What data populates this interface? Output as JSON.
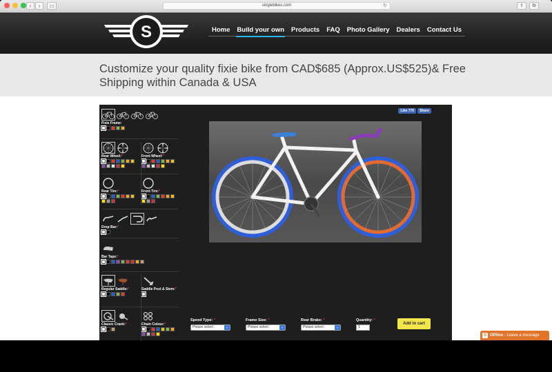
{
  "browser": {
    "url": "singlebikes.com",
    "traffic_lights": [
      "#fc605c",
      "#fdbc40",
      "#34c84a"
    ]
  },
  "header": {
    "logo_letter": "S",
    "nav": [
      {
        "label": "Home",
        "active": false
      },
      {
        "label": "Build your own",
        "active": true
      },
      {
        "label": "Products",
        "active": false
      },
      {
        "label": "FAQ",
        "active": false
      },
      {
        "label": "Photo Gallery",
        "active": false
      },
      {
        "label": "Dealers",
        "active": false
      },
      {
        "label": "Contact Us",
        "active": false
      }
    ]
  },
  "banner": {
    "headline": "Customize your quality fixie bike from CAD$685 (Approx.US$525)& Free Shipping within Canada & USA"
  },
  "social": {
    "like_label": "Like 775",
    "share_label": "Share"
  },
  "options": {
    "fixie_frame": {
      "label": "Fixie Frame:",
      "colors": [
        "#ffffff",
        "#000000",
        "#e23b2b",
        "#7ab648",
        "#f5a623"
      ]
    },
    "rear_wheel": {
      "label": "Rear Wheel:",
      "colors": [
        "#ffffff",
        "#000000",
        "#e23b2b",
        "#1f5fd6",
        "#7ab648",
        "#f5a623",
        "#e8c020",
        "#8b4db8",
        "#c0c0c0",
        "#e8e8e8",
        "#cc3344",
        "#ffdd00"
      ]
    },
    "front_wheel": {
      "label": "Front Wheel:",
      "colors": [
        "#ffffff",
        "#000000",
        "#e23b2b",
        "#1f5fd6",
        "#7ab648",
        "#f5a623",
        "#e8c020",
        "#8b4db8",
        "#c0c0c0",
        "#e8e8e8",
        "#cc3344",
        "#ffdd00"
      ]
    },
    "rear_tire": {
      "label": "Rear Tire:",
      "colors": [
        "#ffffff",
        "#000000",
        "#1f5fd6",
        "#7ab648",
        "#e23b2b",
        "#f5a623",
        "#e8c020",
        "#ffdd00",
        "#999999",
        "#cc3344"
      ]
    },
    "front_tire": {
      "label": "Front Tire:",
      "colors": [
        "#ffffff",
        "#000000",
        "#1f5fd6",
        "#7ab648",
        "#e23b2b",
        "#f5a623",
        "#e8c020",
        "#ffdd00",
        "#999999",
        "#cc3344"
      ]
    },
    "drop_bar": {
      "label": "Drop Bar:",
      "colors": [
        "#ffffff",
        "#000000"
      ]
    },
    "bar_tape": {
      "label": "Bar Tape:",
      "colors": [
        "#ffffff",
        "#000000",
        "#1f5fd6",
        "#8b4db8",
        "#7ab648",
        "#e23b2b",
        "#cc3344",
        "#f5a623",
        "#c8a070"
      ]
    },
    "regular_saddle": {
      "label": "Regular Saddle:",
      "colors": [
        "#ffffff",
        "#000000",
        "#1f5fd6",
        "#7ab648",
        "#e23b2b"
      ]
    },
    "saddle_post": {
      "label": "Saddle Post & Stem:",
      "colors": [
        "#ffffff"
      ]
    },
    "classic_crank": {
      "label": "Classic Crank:",
      "colors": [
        "#ffffff",
        "#000000",
        "#c8a070"
      ]
    },
    "chain_colour": {
      "label": "Chain Colour:",
      "colors": [
        "#ffffff",
        "#000000",
        "#e23b2b",
        "#1f5fd6",
        "#e8c020",
        "#7ab648",
        "#f5a623",
        "#8b4db8",
        "#c0c0c0",
        "#cc3344",
        "#ffdd00"
      ]
    }
  },
  "controls": {
    "speed_type": {
      "label": "Speed Type:",
      "value": "Please select"
    },
    "frame_size": {
      "label": "Frame Size:",
      "value": "Please select"
    },
    "rear_brake": {
      "label": "Rear Brake:",
      "value": "Please select"
    },
    "quantity": {
      "label": "Quantity:",
      "value": "1"
    },
    "add_to_cart": "Add to cart"
  },
  "chat": {
    "status": "Offline",
    "message": "- Leave a message"
  },
  "bike_colors": {
    "frame": "#f2f2f2",
    "rear_tire": "#2f5fd8",
    "front_tire": "#2f5fd8",
    "front_rim": "#e06a30",
    "rear_rim": "#dcdcdc",
    "saddle": "#3a7fd8",
    "bar_tape": "#8b3bb8"
  }
}
